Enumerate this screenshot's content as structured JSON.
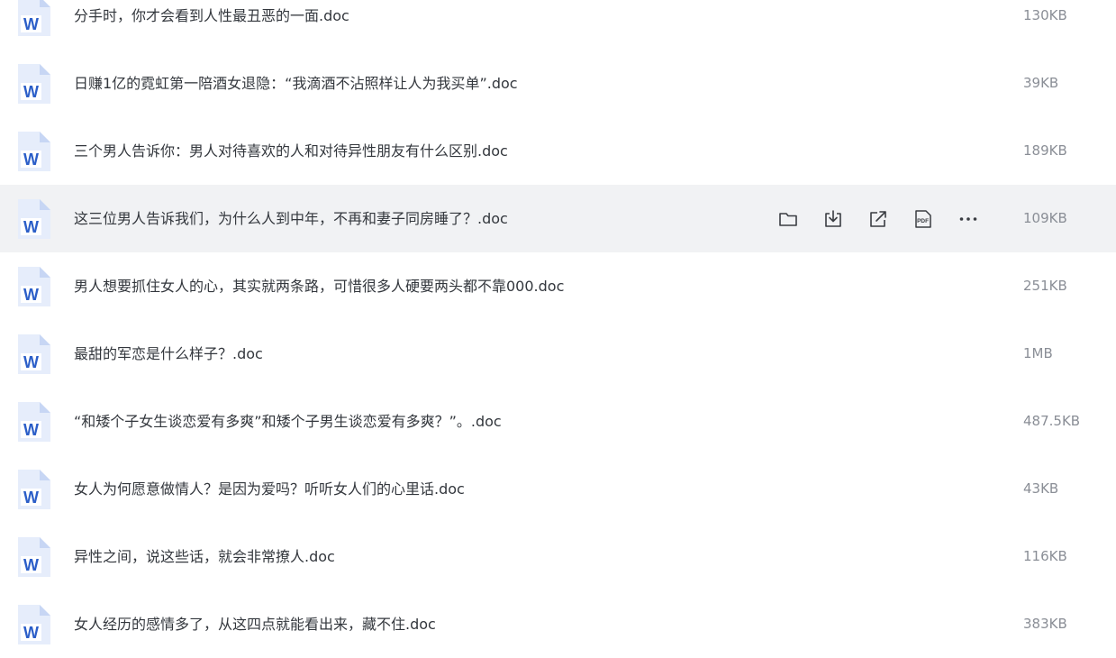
{
  "files": [
    {
      "name": "分手时，你才会看到人性最丑恶的一面.doc",
      "size": "130KB"
    },
    {
      "name": "日赚1亿的霓虹第一陪酒女退隐：“我滴酒不沾照样让人为我买单”.doc",
      "size": "39KB"
    },
    {
      "name": "三个男人告诉你：男人对待喜欢的人和对待异性朋友有什么区别.doc",
      "size": "189KB"
    },
    {
      "name": "这三位男人告诉我们，为什么人到中年，不再和妻子同房睡了？.doc",
      "size": "109KB"
    },
    {
      "name": "男人想要抓住女人的心，其实就两条路，可惜很多人硬要两头都不靠000.doc",
      "size": "251KB"
    },
    {
      "name": "最甜的军恋是什么样子？.doc",
      "size": "1MB"
    },
    {
      "name": "“和矮个子女生谈恋爱有多爽”和矮个子男生谈恋爱有多爽？”。.doc",
      "size": "487.5KB"
    },
    {
      "name": "女人为何愿意做情人？是因为爱吗？听听女人们的心里话.doc",
      "size": "43KB"
    },
    {
      "name": "异性之间，说这些话，就会非常撩人.doc",
      "size": "116KB"
    },
    {
      "name": "女人经历的感情多了，从这四点就能看出来，藏不住.doc",
      "size": "383KB"
    }
  ],
  "hovered_row": 3,
  "row_actions": [
    {
      "icon": "folder-icon",
      "action": "open-folder"
    },
    {
      "icon": "download-icon",
      "action": "download"
    },
    {
      "icon": "share-icon",
      "action": "share"
    },
    {
      "icon": "pdf-icon",
      "action": "convert-pdf",
      "label": "PDF"
    },
    {
      "icon": "more-icon",
      "action": "more"
    }
  ],
  "colors": {
    "word_blue": "#2b5ec8",
    "icon_page": "#e6edfb",
    "icon_fold": "#c7d6f4",
    "hover_bg": "#f1f2f4",
    "text": "#33373d",
    "size_text": "#8a8e96",
    "action_icon": "#3a3d42"
  }
}
